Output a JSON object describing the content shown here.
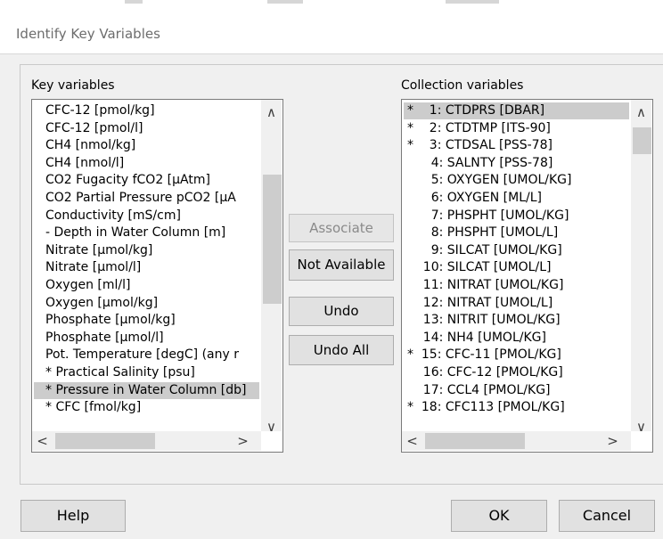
{
  "dialog": {
    "title": "Identify Key Variables"
  },
  "key_panel": {
    "label": "Key variables",
    "items": [
      "CFC-12 [pmol/kg]",
      "CFC-12 [pmol/l]",
      "CH4 [nmol/kg]",
      "CH4 [nmol/l]",
      "CO2 Fugacity fCO2 [µAtm]",
      "CO2 Partial Pressure pCO2 [µA",
      "Conductivity [mS/cm]",
      "- Depth in Water Column [m]",
      "Nitrate [µmol/kg]",
      "Nitrate [µmol/l]",
      "Oxygen [ml/l]",
      "Oxygen [µmol/kg]",
      "Phosphate [µmol/kg]",
      "Phosphate [µmol/l]",
      "Pot. Temperature [degC] (any r",
      "* Practical Salinity [psu]",
      "* Pressure in Water Column [db]",
      "* CFC [fmol/kg]"
    ],
    "selected_index": 16
  },
  "collection_panel": {
    "label": "Collection variables",
    "items": [
      "*    1: CTDPRS [DBAR]",
      "*    2: CTDTMP [ITS-90]",
      "*    3: CTDSAL [PSS-78]",
      "      4: SALNTY [PSS-78]",
      "      5: OXYGEN [UMOL/KG]",
      "      6: OXYGEN [ML/L]",
      "      7: PHSPHT [UMOL/KG]",
      "      8: PHSPHT [UMOL/L]",
      "      9: SILCAT [UMOL/KG]",
      "    10: SILCAT [UMOL/L]",
      "    11: NITRAT [UMOL/KG]",
      "    12: NITRAT [UMOL/L]",
      "    13: NITRIT [UMOL/KG]",
      "    14: NH4 [UMOL/KG]",
      "*  15: CFC-11 [PMOL/KG]",
      "    16: CFC-12 [PMOL/KG]",
      "    17: CCL4 [PMOL/KG]",
      "*  18: CFC113 [PMOL/KG]"
    ],
    "selected_index": 0
  },
  "buttons": {
    "associate": "Associate",
    "not_available": "Not Available",
    "undo": "Undo",
    "undo_all": "Undo All",
    "help": "Help",
    "ok": "OK",
    "cancel": "Cancel"
  },
  "scroll_arrows": {
    "up": "∧",
    "down": "∨",
    "left": "<",
    "right": ">"
  },
  "colors": {
    "selection": "#cccccc",
    "disabled_text": "#8a8a8a"
  }
}
